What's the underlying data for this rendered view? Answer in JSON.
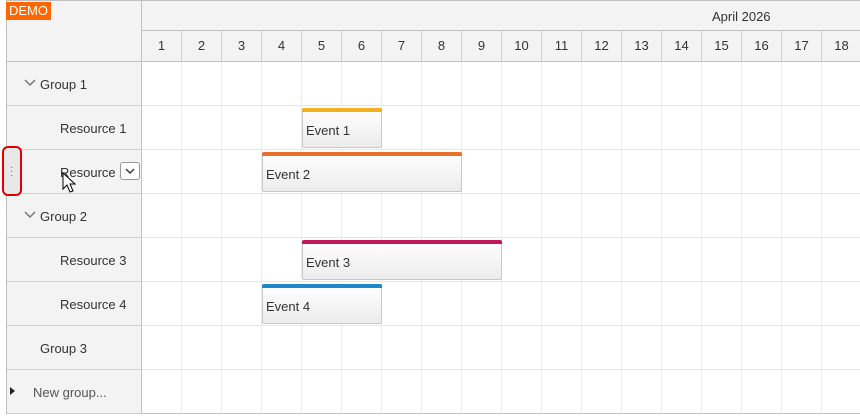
{
  "badge": "DEMO",
  "header": {
    "month": "April 2026",
    "days": [
      "1",
      "2",
      "3",
      "4",
      "5",
      "6",
      "7",
      "8",
      "9",
      "10",
      "11",
      "12",
      "13",
      "14",
      "15",
      "16",
      "17",
      "18"
    ]
  },
  "rows": [
    {
      "label": "Group 1",
      "type": "group",
      "expanded": true
    },
    {
      "label": "Resource 1",
      "type": "resource"
    },
    {
      "label": "Resource 2",
      "type": "resource"
    },
    {
      "label": "Group 2",
      "type": "group",
      "expanded": true
    },
    {
      "label": "Resource 3",
      "type": "resource"
    },
    {
      "label": "Resource 4",
      "type": "resource"
    },
    {
      "label": "Group 3",
      "type": "group-empty"
    },
    {
      "label": "New group...",
      "type": "new"
    }
  ],
  "events": [
    {
      "text": "Event 1",
      "color": "#f2b01e"
    },
    {
      "text": "Event 2",
      "color": "#e8702a"
    },
    {
      "text": "Event 3",
      "color": "#c2185b"
    },
    {
      "text": "Event 4",
      "color": "#1e88c9"
    }
  ],
  "colors": {
    "header_bg": "#f3f3f3",
    "badge_bg": "#ff6600",
    "highlight": "#e00000"
  }
}
